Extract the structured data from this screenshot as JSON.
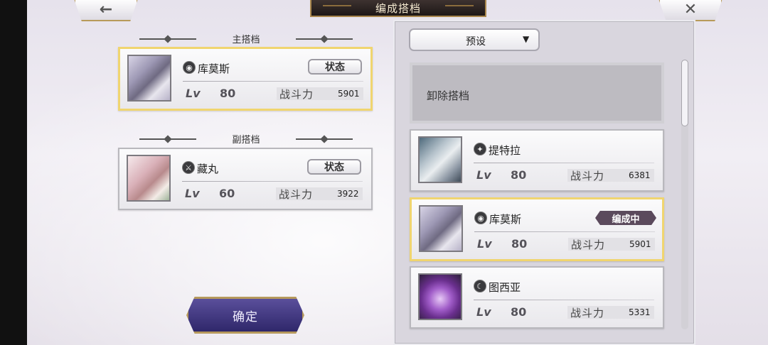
{
  "header": {
    "title": "编成搭档",
    "back_icon": "←",
    "close_icon": "✕"
  },
  "left": {
    "main_label": "主搭档",
    "sub_label": "副搭档",
    "main_card": {
      "name": "库莫斯",
      "element_icon": "eye",
      "element_glyph": "◉",
      "lv_label": "Lv",
      "level": "80",
      "power_label": "战斗力",
      "power": "5901",
      "status_button": "状态"
    },
    "sub_card": {
      "name": "藏丸",
      "element_icon": "sword",
      "element_glyph": "⚔",
      "lv_label": "Lv",
      "level": "60",
      "power_label": "战斗力",
      "power": "3922",
      "status_button": "状态"
    },
    "confirm_button": "确定"
  },
  "right": {
    "preset_label": "预设",
    "preset_arrow": "▼",
    "remove_label": "卸除搭档",
    "list": [
      {
        "name": "提特拉",
        "element_icon": "wind",
        "element_glyph": "✦",
        "lv_label": "Lv",
        "level": "80",
        "power_label": "战斗力",
        "power": "6381",
        "badge": ""
      },
      {
        "name": "库莫斯",
        "element_icon": "eye",
        "element_glyph": "◉",
        "lv_label": "Lv",
        "level": "80",
        "power_label": "战斗力",
        "power": "5901",
        "badge": "编成中"
      },
      {
        "name": "图西亚",
        "element_icon": "moon",
        "element_glyph": "☾",
        "lv_label": "Lv",
        "level": "80",
        "power_label": "战斗力",
        "power": "5331",
        "badge": ""
      }
    ]
  },
  "colors": {
    "selected_border": "#f0d56f",
    "badge_bg": "#5b4a5c",
    "confirm_bg": "#3f3680"
  }
}
